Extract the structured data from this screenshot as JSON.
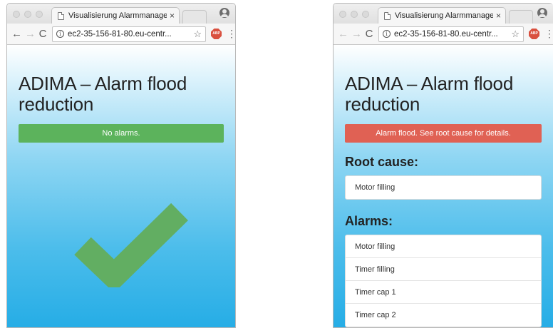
{
  "colors": {
    "success": "#5cb35c",
    "danger": "#e06154",
    "checkmark": "#62ae62",
    "gradient_bottom": "#26ade6"
  },
  "left_window": {
    "tab_title": "Visualisierung Alarmmanagem",
    "url": "ec2-35-156-81-80.eu-centr...",
    "heading": "ADIMA – Alarm flood reduction",
    "status": "No alarms.",
    "status_icon": "checkmark-icon"
  },
  "right_window": {
    "tab_title": "Visualisierung Alarmmanagem",
    "url": "ec2-35-156-81-80.eu-centr...",
    "heading": "ADIMA – Alarm flood reduction",
    "status": "Alarm flood. See root cause for details.",
    "root_cause_title": "Root cause:",
    "root_cause": "Motor filling",
    "alarms_title": "Alarms:",
    "alarms": [
      "Motor filling",
      "Timer filling",
      "Timer cap 1",
      "Timer cap 2"
    ]
  },
  "toolbar": {
    "back": "←",
    "forward": "→",
    "reload": "C",
    "info": "i",
    "star": "☆",
    "abp": "ABP",
    "menu": "⋮",
    "tab_close": "×"
  }
}
